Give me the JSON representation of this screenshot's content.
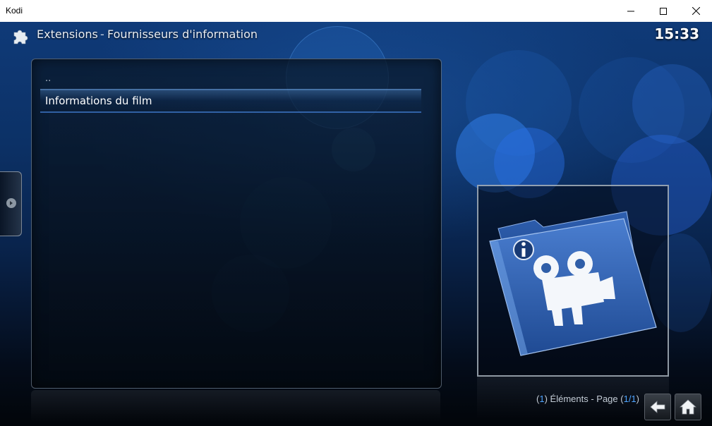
{
  "window": {
    "title": "Kodi",
    "controls": {
      "minimize": "minimize-icon",
      "maximize": "maximize-icon",
      "close": "close-icon"
    }
  },
  "header": {
    "icon": "puzzle-icon",
    "section": "Extensions",
    "separator": "-",
    "subsection": "Fournisseurs d'information",
    "clock": "15:33"
  },
  "list": {
    "items": [
      {
        "label": "..",
        "selected": false
      },
      {
        "label": "Informations du film",
        "selected": true
      }
    ]
  },
  "sidebar_tab": {
    "icon": "arrow-right-icon"
  },
  "thumbnail": {
    "icon": "movie-info-folder-icon"
  },
  "footer": {
    "count": "1",
    "items_label": "Éléments - Page",
    "page": "1/1",
    "back_icon": "back-arrow-icon",
    "home_icon": "home-icon"
  },
  "colors": {
    "accent": "#4fa4ff",
    "background": "#0c3166"
  }
}
